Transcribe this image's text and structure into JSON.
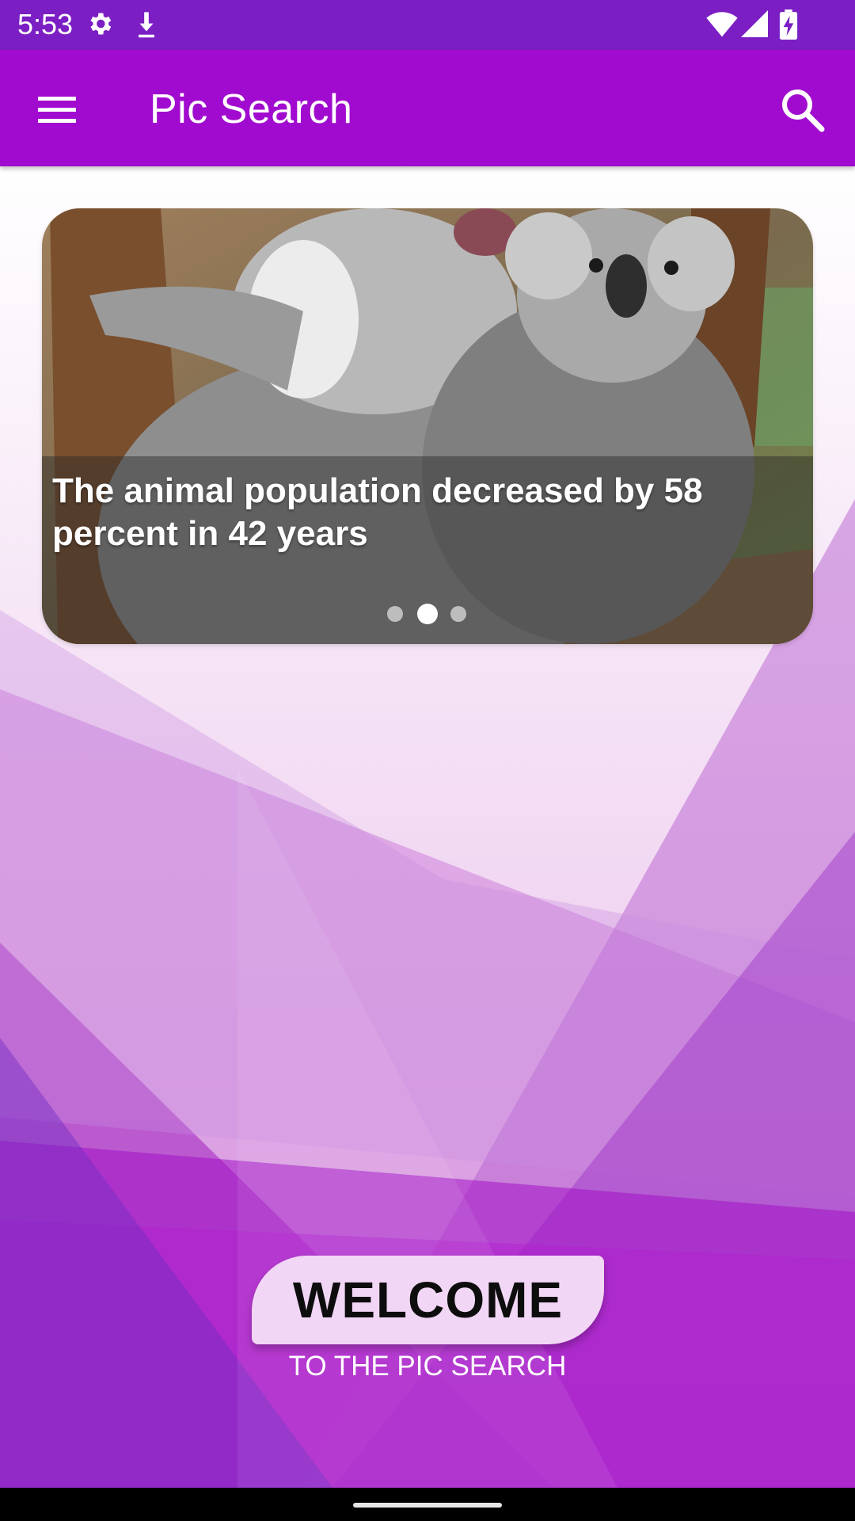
{
  "status_bar": {
    "time": "5:53",
    "left_icons": [
      "settings-icon",
      "download-icon"
    ],
    "right_icons": [
      "wifi-icon",
      "signal-icon",
      "battery-charging-icon"
    ]
  },
  "app_bar": {
    "title": "Pic Search",
    "menu_icon": "hamburger-menu-icon",
    "search_icon": "search-icon",
    "color": "#a10bcf"
  },
  "banner": {
    "caption": "The animal population decreased by 58 percent in 42 years",
    "slide_count": 3,
    "active_slide": 2
  },
  "welcome": {
    "title": "WELCOME",
    "subtitle": "TO THE PIC SEARCH"
  },
  "colors": {
    "status_bar": "#7b1fc4",
    "accent": "#a10bcf",
    "pill": "#f2d6f5"
  }
}
